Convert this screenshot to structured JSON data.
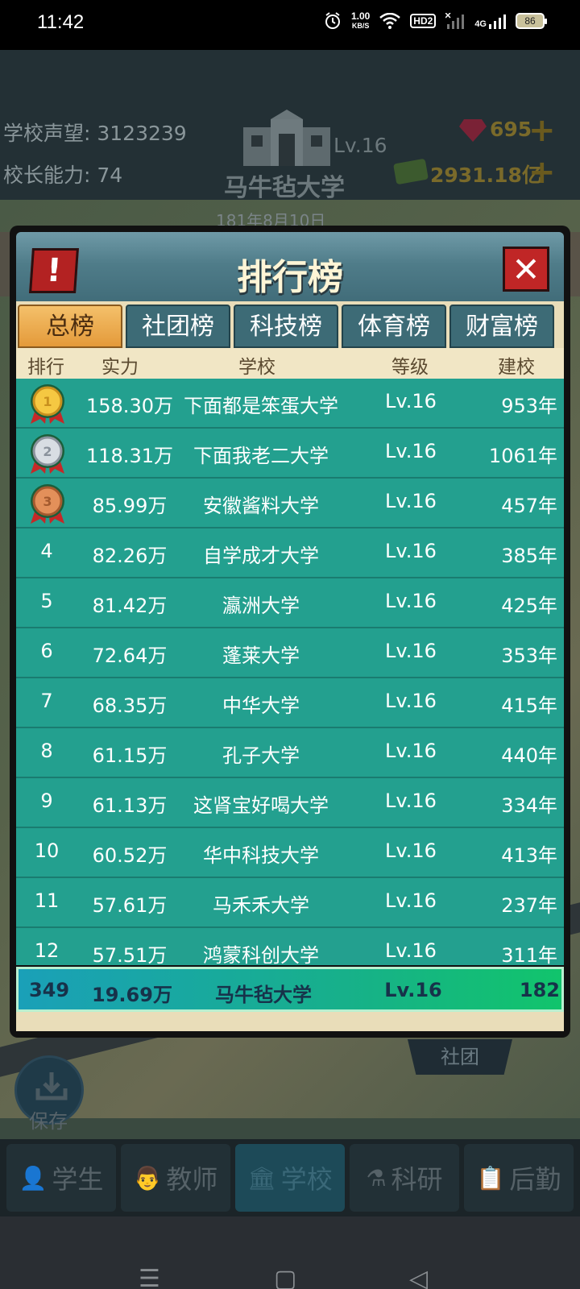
{
  "status_bar": {
    "time": "11:42",
    "speed": "1.00",
    "speed_unit": "KB/S",
    "hd": "HD2",
    "network": "4G",
    "battery": "86"
  },
  "hud": {
    "reputation_label": "学校声望: 3123239",
    "ability_label": "校长能力: 74",
    "school_name": "马牛毡大学",
    "school_level": "Lv.16",
    "gems": "695",
    "money": "2931.18亿",
    "date": "181年8月10日"
  },
  "modal": {
    "title": "排行榜",
    "alert_icon": "!",
    "close_icon": "✕",
    "tabs": [
      {
        "label": "总榜",
        "active": true
      },
      {
        "label": "社团榜",
        "active": false
      },
      {
        "label": "科技榜",
        "active": false
      },
      {
        "label": "体育榜",
        "active": false
      },
      {
        "label": "财富榜",
        "active": false
      }
    ],
    "columns": {
      "rank": "排行",
      "power": "实力",
      "school": "学校",
      "level": "等级",
      "founded": "建校"
    },
    "rows": [
      {
        "rank": "1",
        "power": "158.30万",
        "school": "下面都是笨蛋大学",
        "level": "Lv.16",
        "founded": "953年",
        "medal": "gold"
      },
      {
        "rank": "2",
        "power": "118.31万",
        "school": "下面我老二大学",
        "level": "Lv.16",
        "founded": "1061年",
        "medal": "silver"
      },
      {
        "rank": "3",
        "power": "85.99万",
        "school": "安徽酱料大学",
        "level": "Lv.16",
        "founded": "457年",
        "medal": "bronze"
      },
      {
        "rank": "4",
        "power": "82.26万",
        "school": "自学成才大学",
        "level": "Lv.16",
        "founded": "385年"
      },
      {
        "rank": "5",
        "power": "81.42万",
        "school": "瀛洲大学",
        "level": "Lv.16",
        "founded": "425年"
      },
      {
        "rank": "6",
        "power": "72.64万",
        "school": "蓬莱大学",
        "level": "Lv.16",
        "founded": "353年"
      },
      {
        "rank": "7",
        "power": "68.35万",
        "school": "中华大学",
        "level": "Lv.16",
        "founded": "415年"
      },
      {
        "rank": "8",
        "power": "61.15万",
        "school": "孔子大学",
        "level": "Lv.16",
        "founded": "440年"
      },
      {
        "rank": "9",
        "power": "61.13万",
        "school": "这肾宝好喝大学",
        "level": "Lv.16",
        "founded": "334年"
      },
      {
        "rank": "10",
        "power": "60.52万",
        "school": "华中科技大学",
        "level": "Lv.16",
        "founded": "413年"
      },
      {
        "rank": "11",
        "power": "57.61万",
        "school": "马禾禾大学",
        "level": "Lv.16",
        "founded": "237年"
      },
      {
        "rank": "12",
        "power": "57.51万",
        "school": "鸿蒙科创大学",
        "level": "Lv.16",
        "founded": "311年"
      }
    ],
    "my_row": {
      "rank": "349",
      "power": "19.69万",
      "school": "马牛毡大学",
      "level": "Lv.16",
      "founded": "182"
    }
  },
  "save_label": "保存",
  "club_label": "社团",
  "bottom_nav": [
    {
      "label": "学生",
      "icon": "student-icon",
      "glyph": "👤",
      "active": false
    },
    {
      "label": "教师",
      "icon": "teacher-icon",
      "glyph": "👨",
      "active": false
    },
    {
      "label": "学校",
      "icon": "school-icon",
      "glyph": "🏛",
      "active": true
    },
    {
      "label": "科研",
      "icon": "research-icon",
      "glyph": "⚗",
      "active": false
    },
    {
      "label": "后勤",
      "icon": "logistics-icon",
      "glyph": "📋",
      "active": false
    }
  ],
  "system_nav": {
    "menu": "☰",
    "home": "▢",
    "back": "◁"
  }
}
